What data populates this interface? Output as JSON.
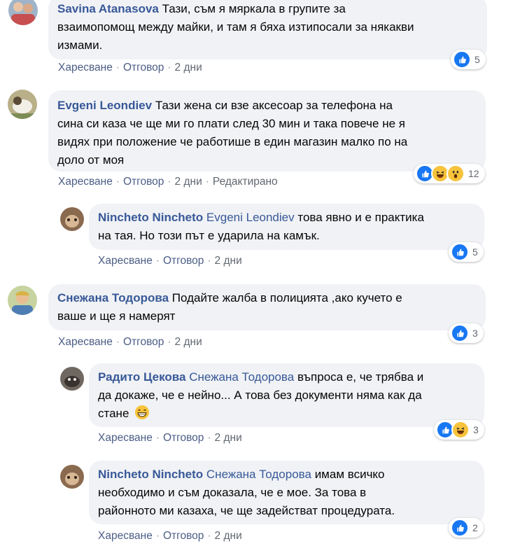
{
  "comments": [
    {
      "author": "Savina Atanasova",
      "text": "Тази, съм я мяркала в групите за взаимопомощ между майки, и там я бяха изтипосали за някакви измами.",
      "line1": "Тази, съм я мяркала в групите за",
      "line2": "взаимопомощ между майки, и там я бяха изтипосали за някакви",
      "line3": "измами.",
      "like": "Харесване",
      "reply": "Отговор",
      "time": "2 дни",
      "reactions": [
        "like"
      ],
      "count": "5"
    },
    {
      "author": "Evgeni Leondiev",
      "line1": "Тази жена си взе аксесоар за телефона на",
      "line2": "сина си каза че ще ми го плати след 30 мин и така повече не я",
      "line3": "видях при положение че работише в един магазин малко по на",
      "line4": "доло от моя",
      "like": "Харесване",
      "reply": "Отговор",
      "time": "2 дни",
      "edited": "Редактирано",
      "reactions": [
        "like",
        "haha",
        "wow"
      ],
      "count": "12"
    },
    {
      "author": "Nincheto Nincheto",
      "mention": "Evgeni Leondiev",
      "line1": "това явно и е практика",
      "line2": "на тая. Но този път е ударила на камък.",
      "like": "Харесване",
      "reply": "Отговор",
      "time": "2 дни",
      "reactions": [
        "like"
      ],
      "count": "5"
    },
    {
      "author": "Снежана Тодорова",
      "line1": "Подайте жалба в полицията ,ако кучето е",
      "line2": "ваше и ще я намерят",
      "like": "Харесване",
      "reply": "Отговор",
      "time": "2 дни",
      "reactions": [
        "like"
      ],
      "count": "3"
    },
    {
      "author": "Радито Цекова",
      "mention": "Снежана Тодорова",
      "line1": "въпроса е, че трябва и",
      "line2": "да докаже, че е нейно... А това без документи няма как да",
      "line3": "стане",
      "like": "Харесване",
      "reply": "Отговор",
      "time": "2 дни",
      "reactions": [
        "like",
        "haha"
      ],
      "count": "3"
    },
    {
      "author": "Nincheto Nincheto",
      "mention": "Снежана Тодорова",
      "line1": "имам всичко",
      "line2": "необходимо и съм доказала, че е мое. За това в",
      "line3": "районното ми казаха, че ще задействат процедурата.",
      "like": "Харесване",
      "reply": "Отговор",
      "time": "2 дни",
      "reactions": [
        "like"
      ],
      "count": "2"
    }
  ],
  "colors": {
    "link": "#385898",
    "bubble": "#f0f2f5",
    "like": "#1877f2"
  }
}
